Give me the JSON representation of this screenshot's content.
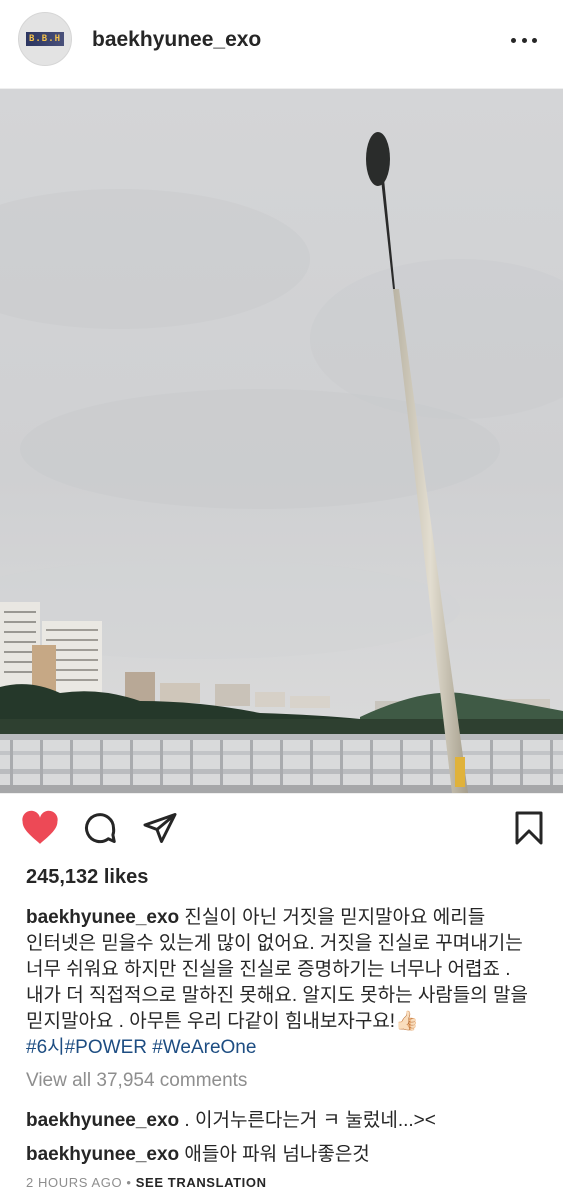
{
  "post": {
    "header": {
      "avatar_text": "B.B.H",
      "username": "baekhyunee_exo",
      "more_icon": "more-horizontal-icon"
    },
    "actions": {
      "like_icon": "heart-filled-icon",
      "like_color": "#ed4956",
      "comment_icon": "comment-icon",
      "share_icon": "share-icon",
      "save_icon": "bookmark-icon"
    },
    "likes": "245,132 likes",
    "caption": {
      "username": "baekhyunee_exo",
      "text": "진실이 아닌 거짓을 믿지말아요 에리들 인터넷은 믿을수 있는게 많이 없어요. 거짓을 진실로 꾸며내기는 너무 쉬워요 하지만 진실을 진실로 증명하기는 너무나 어렵죠 . 내가 더 직접적으로 말하진 못해요. 알지도 못하는 사람들의 말을 믿지말아요 . 아무튼 우리 다같이 힘내보자구요!👍🏻",
      "hashtags": "#6시#POWER #WeAreOne"
    },
    "view_all_comments": "View all 37,954 comments",
    "comments": [
      {
        "username": "baekhyunee_exo",
        "text": ". 이거누른다는거 ㅋ 눌렀네...><"
      },
      {
        "username": "baekhyunee_exo",
        "text": "애들아 파워 넘나좋은것"
      }
    ],
    "timestamp": "2 HOURS AGO",
    "separator": "•",
    "see_translation": "SEE TRANSLATION"
  }
}
